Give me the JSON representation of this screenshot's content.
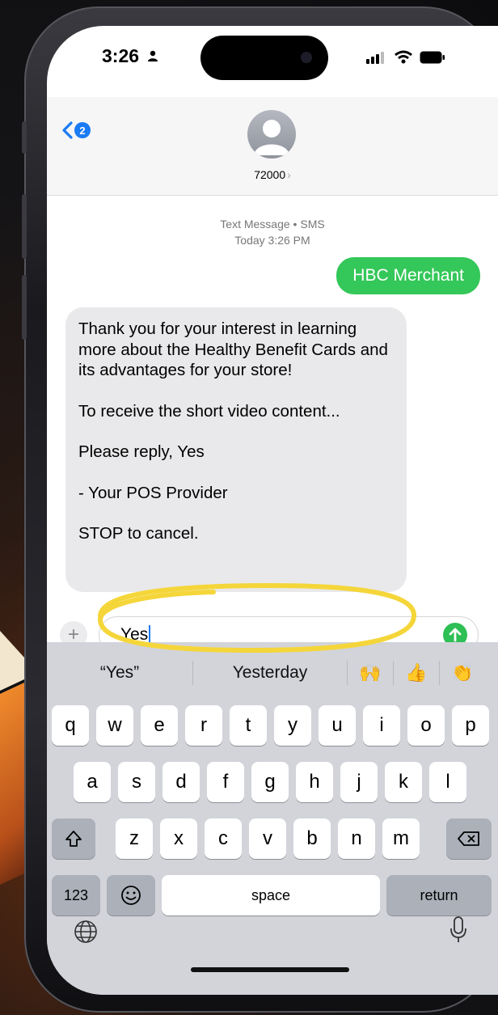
{
  "status_bar": {
    "time": "3:26"
  },
  "header": {
    "back_badge": "2",
    "contact": "72000",
    "contact_chevron": "›"
  },
  "thread": {
    "meta_line1": "Text Message • SMS",
    "meta_line2": "Today 3:26 PM",
    "outgoing": "HBC Merchant",
    "incoming": {
      "p1": "Thank you for your interest in learning more about the Healthy Benefit Cards and its advantages for your store!",
      "p2": "To receive the short video content...",
      "p3": "Please reply, Yes",
      "p4": "- Your POS Provider",
      "p5": "STOP to cancel."
    }
  },
  "composer": {
    "plus": "+",
    "text": "Yes"
  },
  "keyboard": {
    "suggestions": [
      "“Yes”",
      "Yesterday"
    ],
    "suggestion_emoji": [
      "🙌",
      "👍",
      "👏"
    ],
    "row1": [
      "q",
      "w",
      "e",
      "r",
      "t",
      "y",
      "u",
      "i",
      "o",
      "p"
    ],
    "row2": [
      "a",
      "s",
      "d",
      "f",
      "g",
      "h",
      "j",
      "k",
      "l"
    ],
    "row3": [
      "z",
      "x",
      "c",
      "v",
      "b",
      "n",
      "m"
    ],
    "numbers_label": "123",
    "space_label": "space",
    "return_label": "return",
    "emoji_key": "☺"
  },
  "colors": {
    "accent_blue": "#1a7bf5",
    "imessage_green": "#34c759",
    "highlight_yellow": "#f5d63a"
  },
  "icons": [
    "person-icon",
    "signal-icon",
    "wifi-icon",
    "battery-icon",
    "back-chevron-icon",
    "avatar-icon",
    "send-arrow-icon",
    "shift-icon",
    "backspace-icon",
    "emoji-icon",
    "globe-icon",
    "mic-icon"
  ]
}
